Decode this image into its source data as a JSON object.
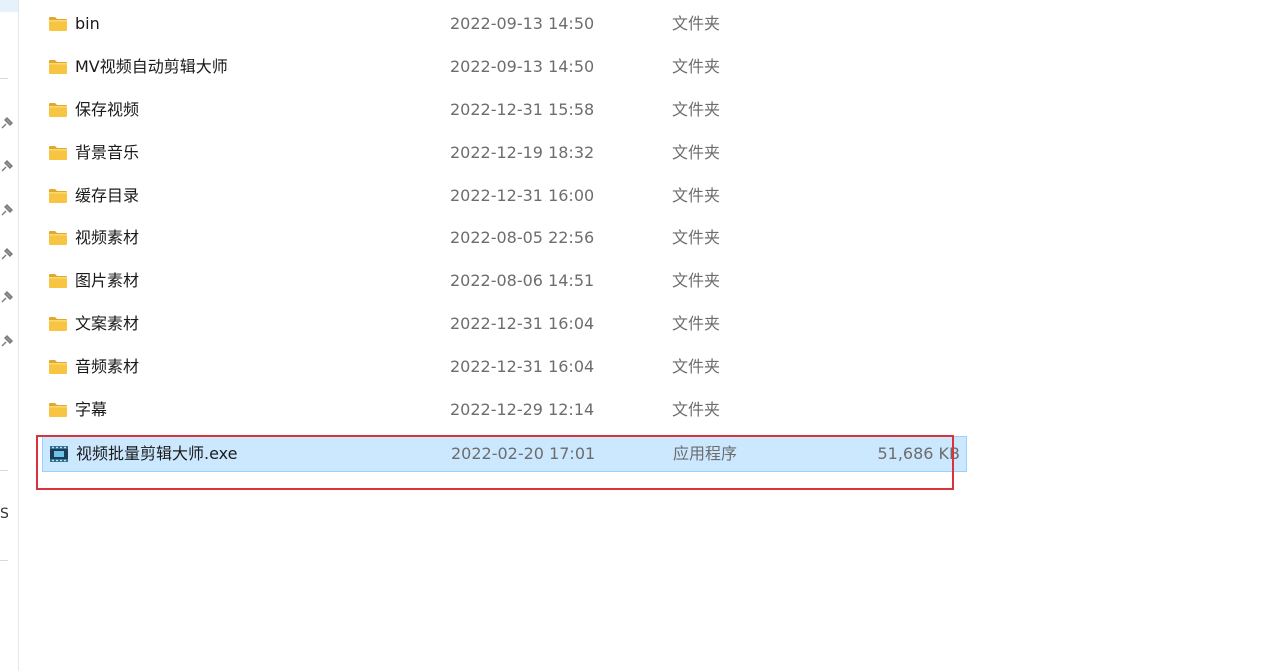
{
  "files": [
    {
      "name": "bin",
      "modified": "2022-09-13 14:50",
      "type": "文件夹",
      "size": "",
      "icon": "folder-icon"
    },
    {
      "name": "MV视频自动剪辑大师",
      "modified": "2022-09-13 14:50",
      "type": "文件夹",
      "size": "",
      "icon": "folder-icon"
    },
    {
      "name": "保存视频",
      "modified": "2022-12-31 15:58",
      "type": "文件夹",
      "size": "",
      "icon": "folder-icon"
    },
    {
      "name": "背景音乐",
      "modified": "2022-12-19 18:32",
      "type": "文件夹",
      "size": "",
      "icon": "folder-icon"
    },
    {
      "name": "缓存目录",
      "modified": "2022-12-31 16:00",
      "type": "文件夹",
      "size": "",
      "icon": "folder-icon"
    },
    {
      "name": "视频素材",
      "modified": "2022-08-05 22:56",
      "type": "文件夹",
      "size": "",
      "icon": "folder-icon"
    },
    {
      "name": "图片素材",
      "modified": "2022-08-06 14:51",
      "type": "文件夹",
      "size": "",
      "icon": "folder-icon"
    },
    {
      "name": "文案素材",
      "modified": "2022-12-31 16:04",
      "type": "文件夹",
      "size": "",
      "icon": "folder-icon"
    },
    {
      "name": "音频素材",
      "modified": "2022-12-31 16:04",
      "type": "文件夹",
      "size": "",
      "icon": "folder-icon"
    },
    {
      "name": "字幕",
      "modified": "2022-12-29 12:14",
      "type": "文件夹",
      "size": "",
      "icon": "folder-icon"
    },
    {
      "name": "视频批量剪辑大师.exe",
      "modified": "2022-02-20 17:01",
      "type": "应用程序",
      "size": "51,686 KB",
      "icon": "application-icon",
      "selected": true
    }
  ],
  "nav": {
    "pinned_icon": "pin-icon",
    "partial_glyph": "S"
  },
  "colors": {
    "selection_bg": "#cce8ff",
    "selection_border": "#99d1ff",
    "highlight_annotation": "#d9343e",
    "folder": "#f8c542",
    "folder_dark": "#e0a82e"
  }
}
